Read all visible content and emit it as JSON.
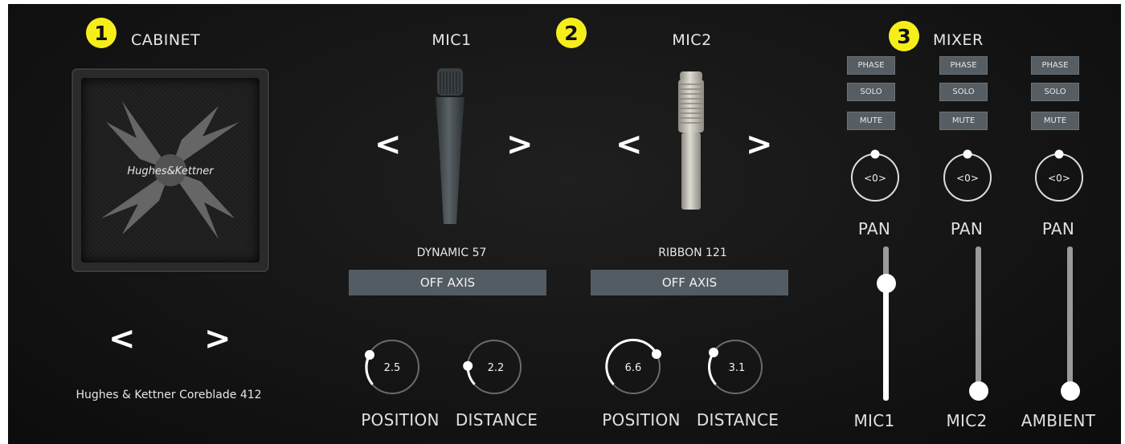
{
  "badges": [
    "1",
    "2",
    "3"
  ],
  "cabinet": {
    "title": "CABINET",
    "logo_text": "Hughes&Kettner",
    "name": "Hughes & Kettner Coreblade 412",
    "prev": "<",
    "next": ">"
  },
  "mic1": {
    "title": "MIC1",
    "model": "DYNAMIC 57",
    "off_axis": "OFF AXIS",
    "prev": "<",
    "next": ">",
    "position": "2.5",
    "distance": "2.2",
    "position_label": "POSITION",
    "distance_label": "DISTANCE"
  },
  "mic2": {
    "title": "MIC2",
    "model": "RIBBON 121",
    "off_axis": "OFF AXIS",
    "prev": "<",
    "next": ">",
    "position": "6.6",
    "distance": "3.1",
    "position_label": "POSITION",
    "distance_label": "DISTANCE"
  },
  "mixer": {
    "title": "MIXER",
    "channels": [
      {
        "phase": "PHASE",
        "solo": "SOLO",
        "mute": "MUTE",
        "pan_value": "<0>",
        "pan_label": "PAN",
        "name": "MIC1",
        "level": 0.8
      },
      {
        "phase": "PHASE",
        "solo": "SOLO",
        "mute": "MUTE",
        "pan_value": "<0>",
        "pan_label": "PAN",
        "name": "MIC2",
        "level": 0.0
      },
      {
        "phase": "PHASE",
        "solo": "SOLO",
        "mute": "MUTE",
        "pan_value": "<0>",
        "pan_label": "PAN",
        "name": "AMBIENT",
        "level": 0.0
      }
    ]
  },
  "colors": {
    "badge": "#f6ee1a",
    "panel_bg": "#141414",
    "button": "#565d63",
    "accent": "#ffffff"
  }
}
